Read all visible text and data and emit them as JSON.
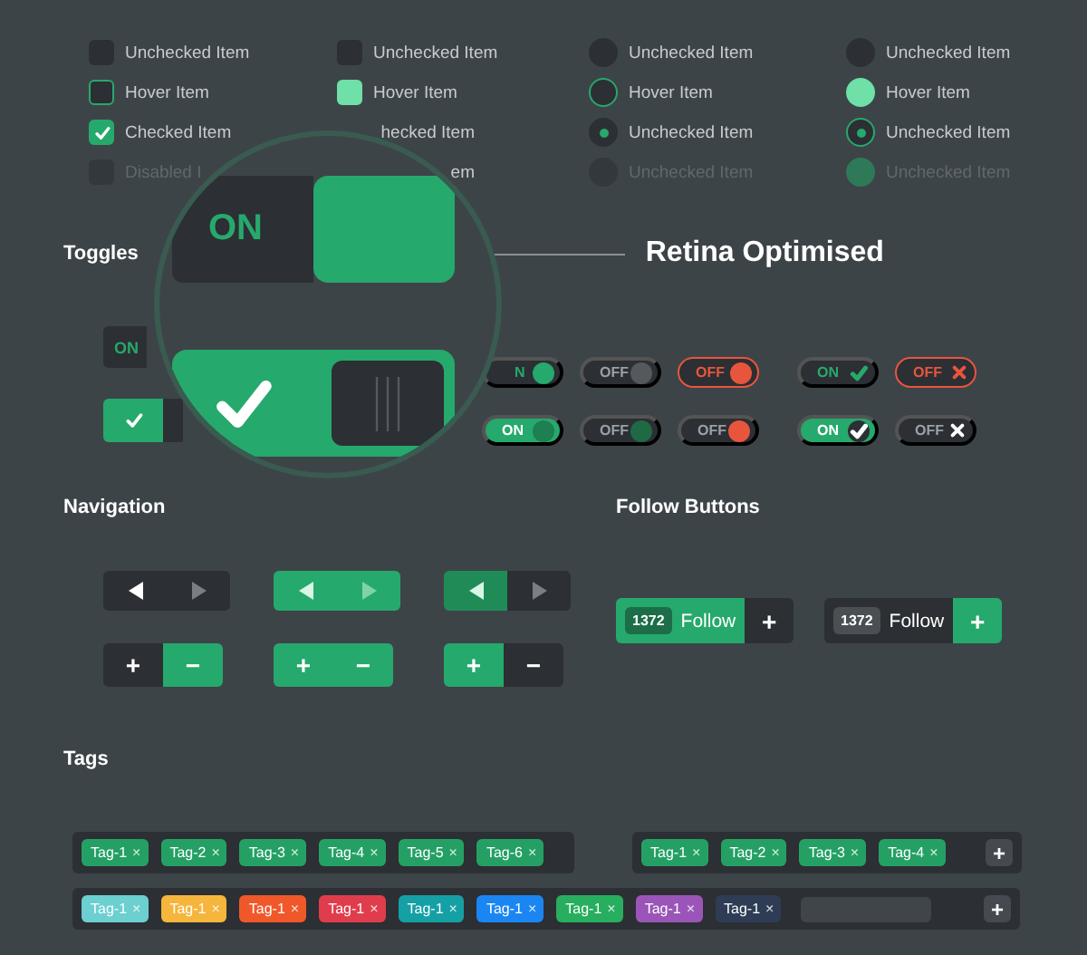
{
  "checks": {
    "columns": [
      {
        "kind": "checkbox",
        "items": [
          {
            "label": "Unchecked Item",
            "kind": "normal",
            "checked": false
          },
          {
            "label": "Hover Item",
            "kind": "hover",
            "checked": false
          },
          {
            "label": "Checked Item",
            "kind": "normal",
            "checked": true
          },
          {
            "label": "Disabled I",
            "kind": "disabled",
            "checked": false
          }
        ]
      },
      {
        "kind": "tile",
        "items": [
          {
            "label": "Unchecked Item",
            "kind": "normal",
            "checked": false
          },
          {
            "label": "Hover Item",
            "kind": "hover",
            "checked": false
          },
          {
            "label": "hecked Item",
            "kind": "covered"
          },
          {
            "label": "em",
            "kind": "covered"
          }
        ]
      },
      {
        "kind": "radio",
        "items": [
          {
            "label": "Unchecked Item",
            "kind": "normal",
            "checked": false
          },
          {
            "label": "Hover Item",
            "kind": "hover",
            "checked": false
          },
          {
            "label": "Unchecked Item",
            "kind": "normal",
            "checked": true
          },
          {
            "label": "Unchecked Item",
            "kind": "disabled",
            "checked": false
          }
        ]
      },
      {
        "kind": "dot",
        "items": [
          {
            "label": "Unchecked Item",
            "kind": "normal",
            "checked": false
          },
          {
            "label": "Hover Item",
            "kind": "hover",
            "checked": false
          },
          {
            "label": "Unchecked Item",
            "kind": "normal",
            "checked": true
          },
          {
            "label": "Unchecked Item",
            "kind": "disabled",
            "checked": false
          }
        ]
      }
    ]
  },
  "toggles": {
    "title": "Toggles",
    "banner": "Retina Optimised",
    "magnifier": [
      {
        "kind": "label",
        "label": "ON",
        "on": true
      },
      {
        "kind": "check",
        "on": true
      }
    ],
    "left": [
      {
        "kind": "label",
        "label": "ON",
        "on": true
      },
      {
        "kind": "check",
        "on": true
      }
    ],
    "rows": [
      [
        {
          "kind": "dark",
          "label": "N",
          "on": true,
          "knob": {
            "kind": "dot",
            "color": "#26a96c"
          }
        },
        {
          "kind": "dark",
          "label": "OFF",
          "on": false,
          "knob": {
            "kind": "dot",
            "color": "#55595d"
          }
        },
        {
          "kind": "alert",
          "label": "OFF",
          "on": false,
          "knob": {
            "kind": "dot",
            "color": "#e8553d"
          }
        },
        {
          "kind": "dark",
          "label": "ON",
          "on": true,
          "knob": {
            "kind": "check",
            "color": "#26a96c"
          }
        },
        {
          "kind": "alert",
          "label": "OFF",
          "on": false,
          "knob": {
            "kind": "cross",
            "color": "#e8553d"
          }
        }
      ],
      [
        {
          "kind": "green",
          "label": "ON",
          "on": true,
          "knob": {
            "kind": "dot",
            "color": "#1d7f52"
          }
        },
        {
          "kind": "dark",
          "label": "OFF",
          "on": false,
          "knob": {
            "kind": "dot",
            "color": "#1f6a45"
          }
        },
        {
          "kind": "dark",
          "label": "OFF",
          "on": false,
          "knob": {
            "kind": "dot",
            "color": "#e8553d"
          }
        },
        {
          "kind": "green",
          "label": "ON",
          "on": true,
          "knob": {
            "kind": "check",
            "color": "#ffffff"
          }
        },
        {
          "kind": "dark",
          "label": "OFF",
          "on": false,
          "knob": {
            "kind": "cross",
            "color": "#ffffff"
          }
        }
      ]
    ]
  },
  "navigation": {
    "title": "Navigation",
    "groups": [
      {
        "arrows": [
          {
            "kind": "dark",
            "dim": false
          },
          {
            "kind": "dark",
            "dim": true
          }
        ],
        "stepper": [
          {
            "symbol": "+",
            "kind": "dark"
          },
          {
            "symbol": "−",
            "kind": "green"
          }
        ]
      },
      {
        "arrows": [
          {
            "kind": "green",
            "dim": false
          },
          {
            "kind": "green",
            "dim": true
          }
        ],
        "stepper": [
          {
            "symbol": "+",
            "kind": "green"
          },
          {
            "symbol": "−",
            "kind": "green"
          }
        ]
      },
      {
        "arrows": [
          {
            "kind": "deep",
            "dim": false
          },
          {
            "kind": "dark",
            "dim": true
          }
        ],
        "stepper": [
          {
            "symbol": "+",
            "kind": "green"
          },
          {
            "symbol": "−",
            "kind": "dark"
          }
        ]
      }
    ]
  },
  "follow": {
    "title": "Follow Buttons",
    "buttons": [
      {
        "count": "1372",
        "label": "Follow",
        "symbol": "+",
        "kind": "green"
      },
      {
        "count": "1372",
        "label": "Follow",
        "symbol": "+",
        "kind": "dark"
      }
    ]
  },
  "tags": {
    "title": "Tags",
    "panels": [
      {
        "tags": [
          {
            "label": "Tag-1",
            "remove": "×",
            "color": "#25a065"
          },
          {
            "label": "Tag-2",
            "remove": "×",
            "color": "#25a065"
          },
          {
            "label": "Tag-3",
            "remove": "×",
            "color": "#25a065"
          },
          {
            "label": "Tag-4",
            "remove": "×",
            "color": "#25a065"
          },
          {
            "label": "Tag-5",
            "remove": "×",
            "color": "#25a065"
          },
          {
            "label": "Tag-6",
            "remove": "×",
            "color": "#25a065"
          }
        ]
      },
      {
        "add_symbol": "+",
        "tags": [
          {
            "label": "Tag-1",
            "remove": "×",
            "color": "#25a065"
          },
          {
            "label": "Tag-2",
            "remove": "×",
            "color": "#25a065"
          },
          {
            "label": "Tag-3",
            "remove": "×",
            "color": "#25a065"
          },
          {
            "label": "Tag-4",
            "remove": "×",
            "color": "#25a065"
          }
        ]
      },
      {
        "add_symbol": "+",
        "input": true,
        "tags": [
          {
            "label": "Tag-1",
            "remove": "×",
            "color": "#6ccfd0"
          },
          {
            "label": "Tag-1",
            "remove": "×",
            "color": "#f6b53c"
          },
          {
            "label": "Tag-1",
            "remove": "×",
            "color": "#f0582a"
          },
          {
            "label": "Tag-1",
            "remove": "×",
            "color": "#e03d4c"
          },
          {
            "label": "Tag-1",
            "remove": "×",
            "color": "#15a0a6"
          },
          {
            "label": "Tag-1",
            "remove": "×",
            "color": "#1b86f2"
          },
          {
            "label": "Tag-1",
            "remove": "×",
            "color": "#27ae5f"
          },
          {
            "label": "Tag-1",
            "remove": "×",
            "color": "#9b55b8"
          },
          {
            "label": "Tag-1",
            "remove": "×",
            "color": "#2e3d55"
          }
        ]
      }
    ]
  }
}
